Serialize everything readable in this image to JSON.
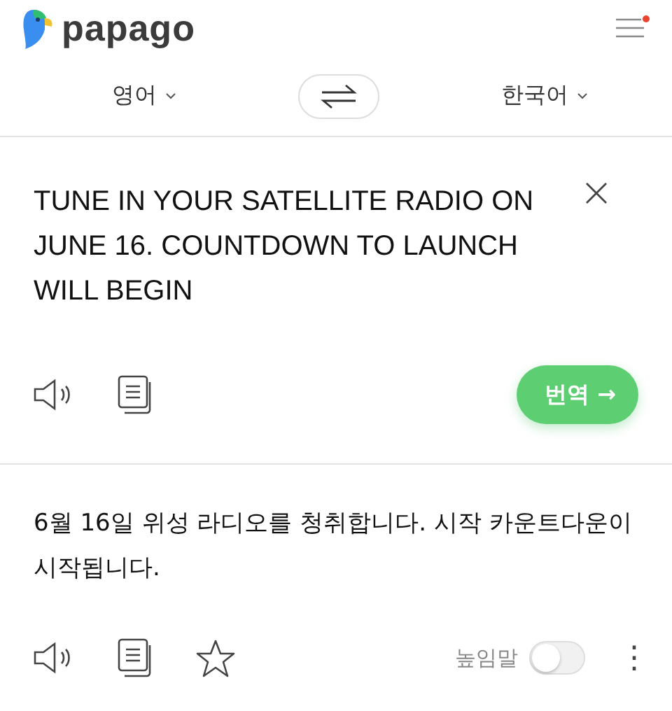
{
  "brand": {
    "name": "papago"
  },
  "menu": {
    "notification": true
  },
  "languages": {
    "source": "영어",
    "target": "한국어"
  },
  "source": {
    "text": "TUNE IN YOUR SATELLITE RADIO ON JUNE 16. COUNTDOWN TO LAUNCH WILL BEGIN",
    "translate_button": "번역",
    "arrow": "→"
  },
  "result": {
    "text": "6월 16일 위성 라디오를 청취합니다. 시작 카운트다운이 시작됩니다.",
    "favorite": false,
    "honorific": {
      "label": "높임말",
      "on": false
    },
    "more": "⋮"
  }
}
